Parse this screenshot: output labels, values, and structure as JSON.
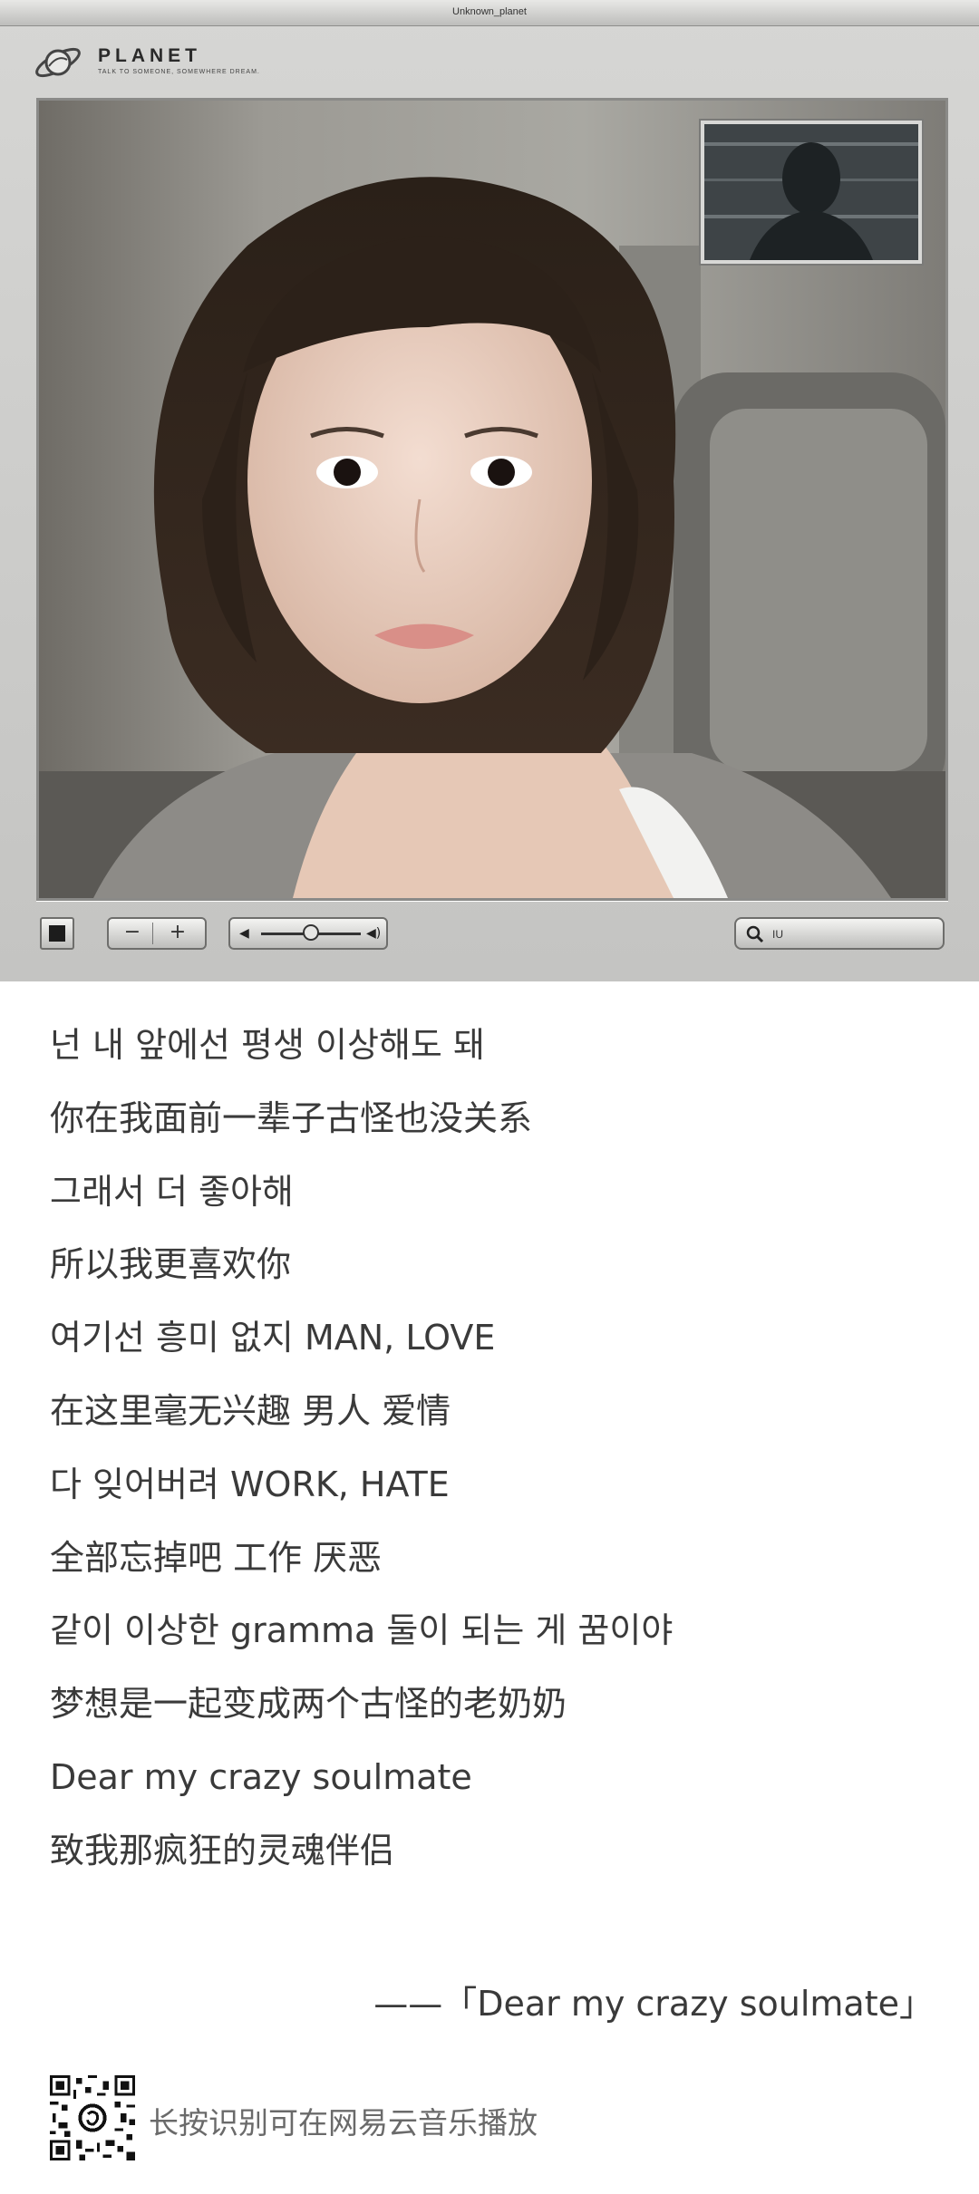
{
  "window": {
    "title": "Unknown_planet",
    "brand": {
      "name": "PLANET",
      "tagline": "TALK TO SOMEONE, SOMEWHERE DREAM."
    }
  },
  "controls": {
    "stop_icon": "stop-icon",
    "zoom_out": "−",
    "zoom_in": "+",
    "volume_level": 0.5,
    "search_value": "IU"
  },
  "lyrics": [
    "넌 내 앞에선 평생 이상해도 돼",
    "你在我面前一辈子古怪也没关系",
    "그래서 더 좋아해",
    "所以我更喜欢你",
    "여기선 흥미 없지 MAN, LOVE",
    "在这里毫无兴趣 男人 爱情",
    "다 잊어버려 WORK, HATE",
    "全部忘掉吧 工作 厌恶",
    "같이 이상한 gramma 둘이 되는 게 꿈이야",
    "梦想是一起变成两个古怪的老奶奶",
    "Dear my crazy soulmate",
    "致我那疯狂的灵魂伴侣"
  ],
  "credit": "——「Dear my crazy soulmate」",
  "footer": {
    "text": "长按识别可在网易云音乐播放"
  }
}
